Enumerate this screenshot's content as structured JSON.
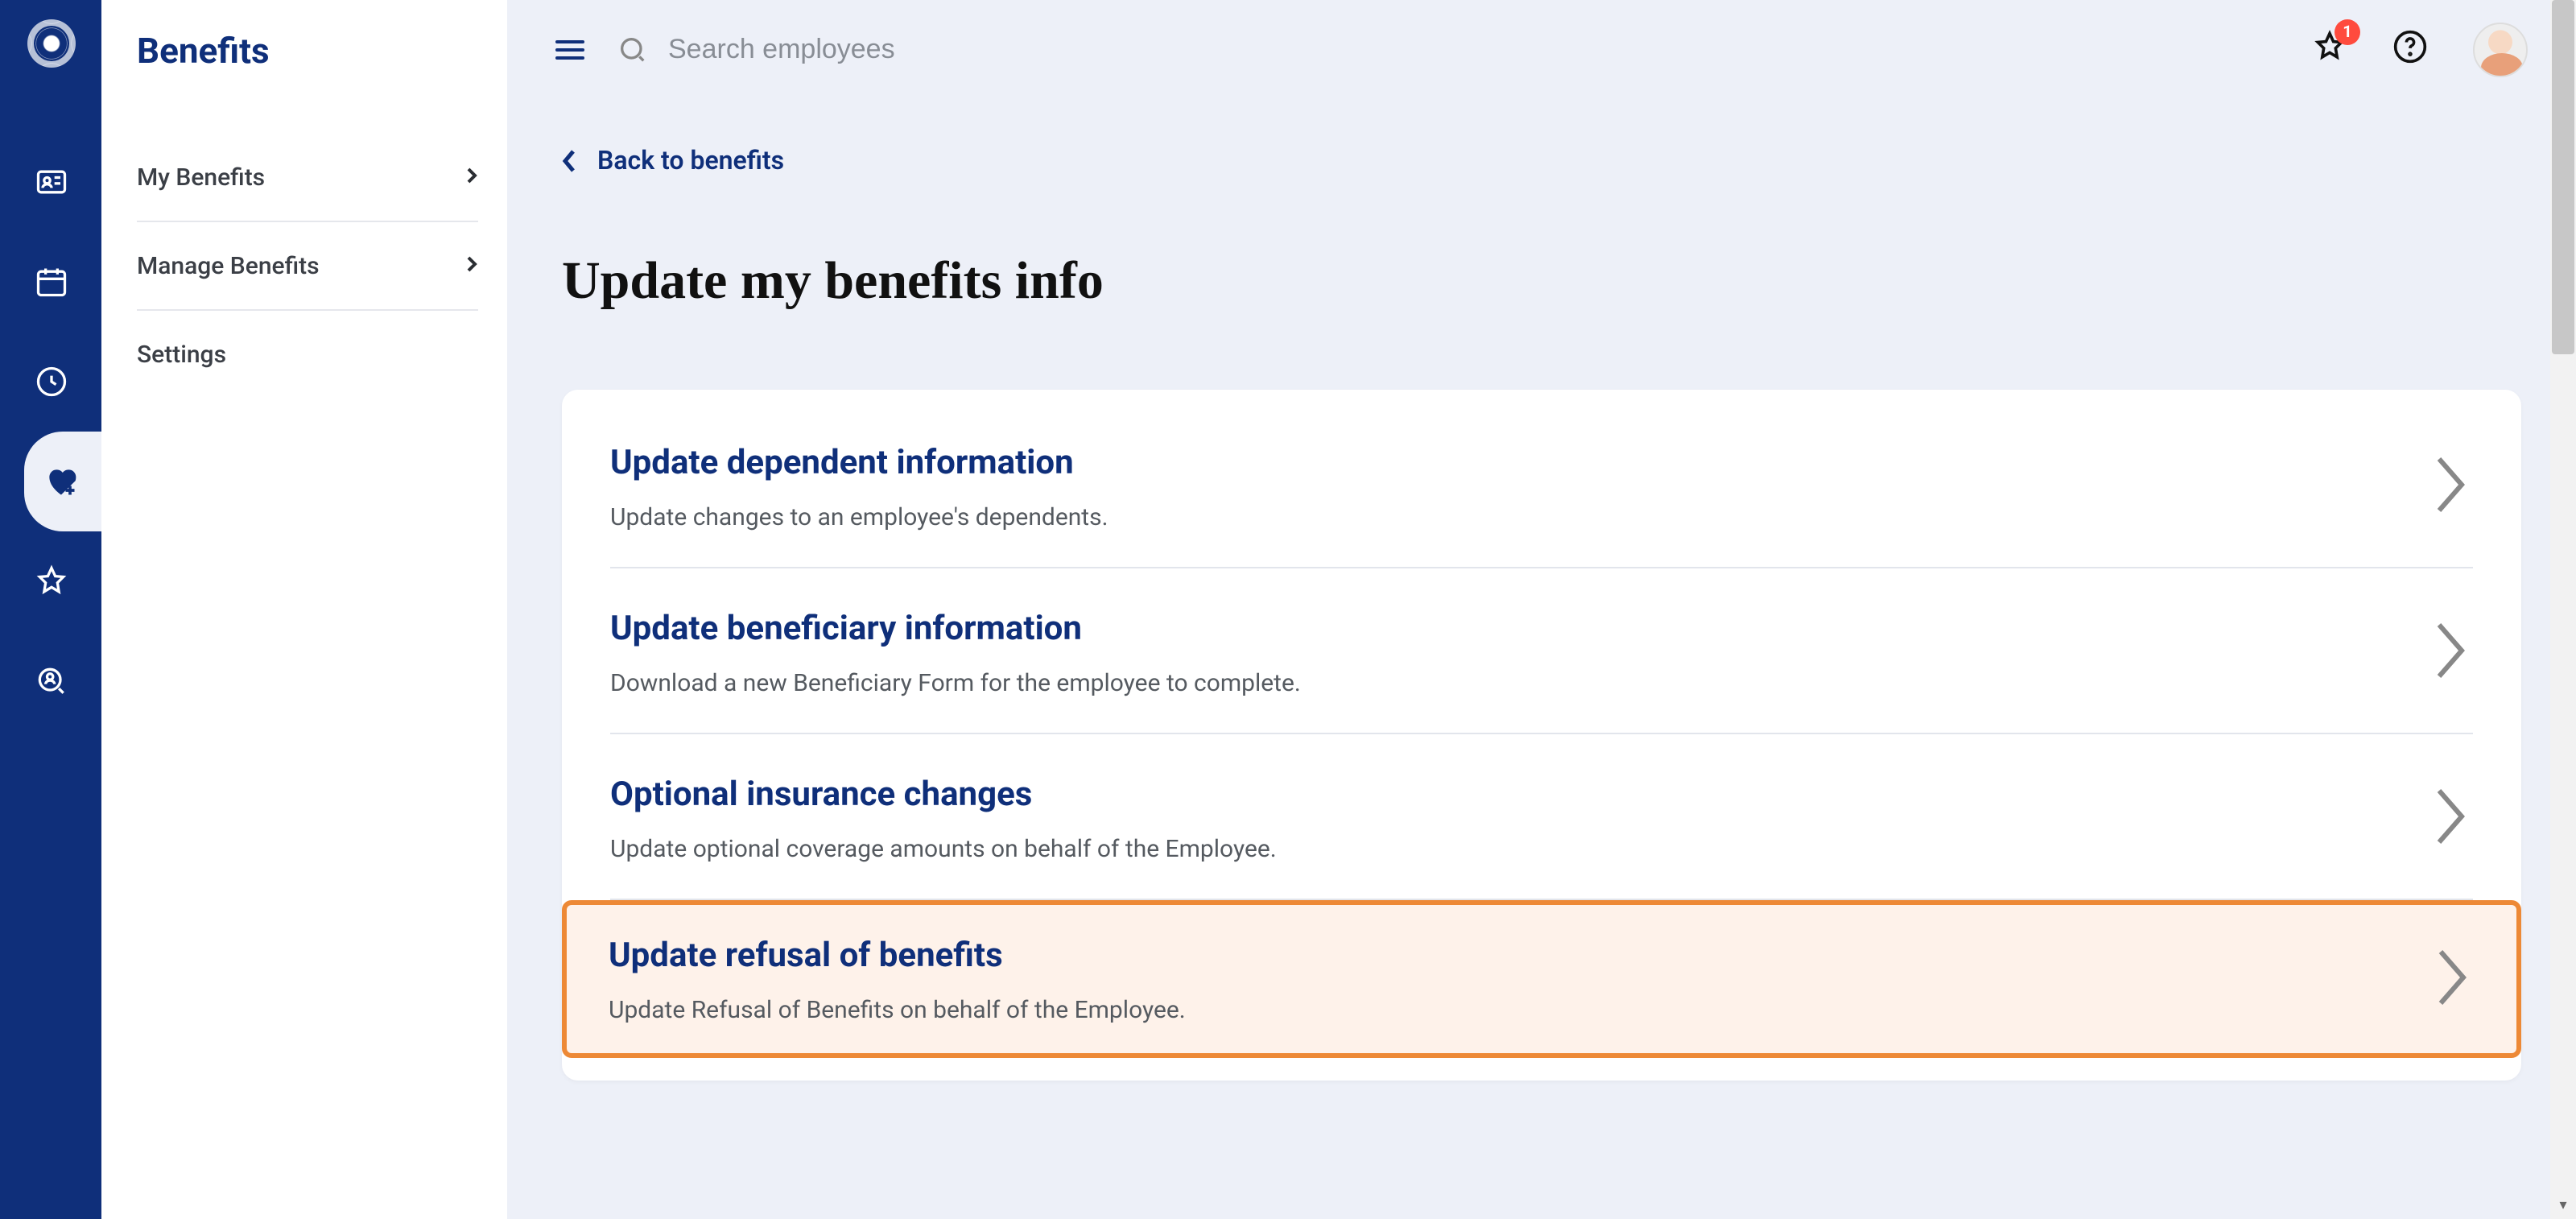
{
  "sidebar_title": "Benefits",
  "sidebar_items": [
    {
      "label": "My Benefits",
      "has_chevron": true
    },
    {
      "label": "Manage Benefits",
      "has_chevron": true
    },
    {
      "label": "Settings",
      "has_chevron": false
    }
  ],
  "search": {
    "placeholder": "Search employees"
  },
  "notification_count": "1",
  "back_link": "Back to benefits",
  "page_title": "Update my benefits info",
  "options": [
    {
      "title": "Update dependent information",
      "description": "Update changes to an employee's dependents.",
      "highlighted": false
    },
    {
      "title": "Update beneficiary information",
      "description": "Download a new Beneficiary Form for the employee to complete.",
      "highlighted": false
    },
    {
      "title": "Optional insurance changes",
      "description": "Update optional coverage amounts on behalf of the Employee.",
      "highlighted": false
    },
    {
      "title": "Update refusal of benefits",
      "description": "Update Refusal of Benefits on behalf of the Employee.",
      "highlighted": true
    }
  ]
}
